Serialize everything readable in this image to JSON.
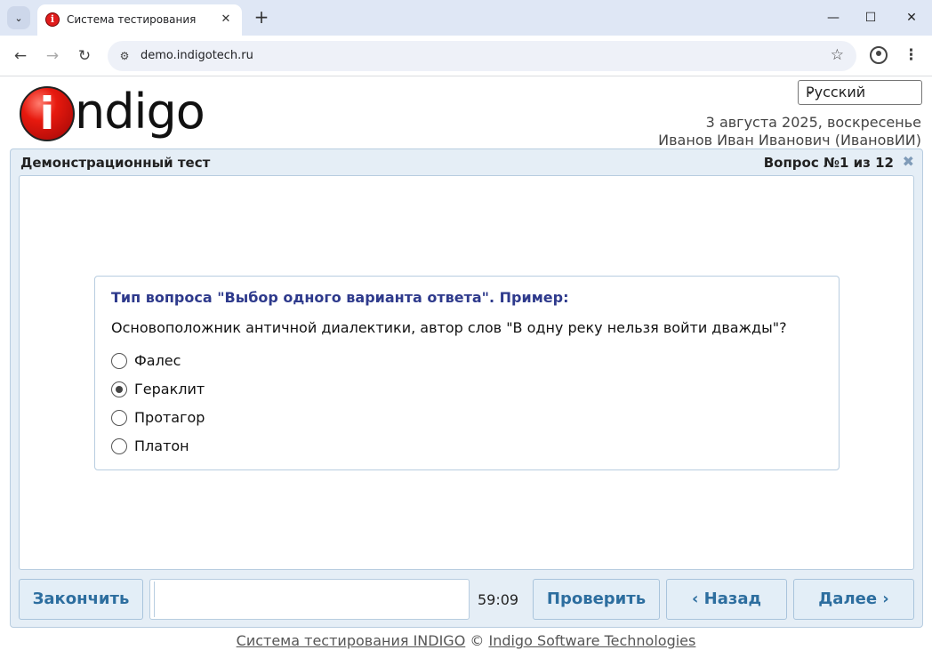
{
  "browser": {
    "tab_title": "Система тестирования",
    "url": "demo.indigotech.ru"
  },
  "header": {
    "logo_text": "ndigo",
    "logo_letter": "i",
    "language": "Русский",
    "date": "3 августа 2025, воскресенье",
    "user": "Иванов Иван Иванович (ИвановИИ)"
  },
  "test": {
    "title": "Демонстрационный тест",
    "question_counter": "Вопрос №1 из 12",
    "question": {
      "type": "Тип вопроса \"Выбор одного варианта ответа\". Пример:",
      "text": "Основоположник античной диалектики, автор слов \"В одну реку нельзя войти дважды\"?",
      "options": [
        {
          "label": "Фалес",
          "checked": false
        },
        {
          "label": "Гераклит",
          "checked": true
        },
        {
          "label": "Протагор",
          "checked": false
        },
        {
          "label": "Платон",
          "checked": false
        }
      ]
    }
  },
  "controls": {
    "finish": "Закончить",
    "timer": "59:09",
    "check": "Проверить",
    "back": "‹ Назад",
    "next": "Далее ›"
  },
  "footer": {
    "system": "Система тестирования INDIGO",
    "copyright": "©",
    "company": "Indigo Software Technologies"
  }
}
